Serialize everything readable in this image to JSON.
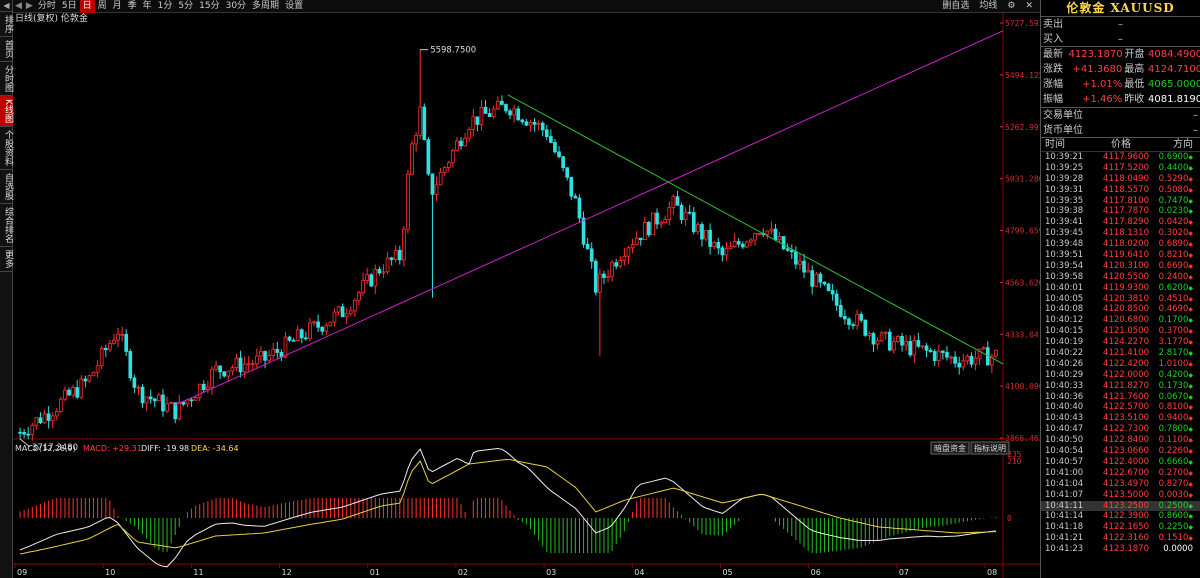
{
  "leftnav": {
    "items": [
      "排序",
      "首页",
      "分时图",
      "K线图",
      "个股资料",
      "自选股",
      "综合排名",
      "更多"
    ],
    "active_index": 3
  },
  "toolbar": {
    "items": [
      "分时",
      "5日",
      "日",
      "周",
      "月",
      "季",
      "年",
      "1分",
      "5分",
      "15分",
      "30分",
      "多周期",
      "设置"
    ],
    "selected": "日",
    "right_items": [
      "删自选",
      "均线"
    ]
  },
  "chart": {
    "title": "日线(复权) 伦敦金",
    "y_ticks": [
      "5727.591",
      "5494.125",
      "5262.997",
      "5031.280",
      "4799.659",
      "4563.626",
      "4333.041",
      "4100.096",
      "3866.463"
    ],
    "x_ticks": [
      "09",
      "10",
      "11",
      "12",
      "01",
      "02",
      "03",
      "04",
      "05",
      "06",
      "07",
      "08"
    ],
    "annot_high": "5598.7500",
    "annot_low": "3717.3480",
    "macd_label": "MACD(12,26,9)",
    "macd_value": "MACD: +29.31",
    "diff_value": "DIFF: -19.98",
    "dea_value": "DEA: -34.64",
    "macd_btn1": "暗盘资金",
    "macd_btn2": "指标说明",
    "macd_y_ticks": [
      "235",
      "210",
      "0"
    ]
  },
  "chart_data": {
    "type": "candlestick",
    "title": "日线(复权) 伦敦金",
    "ylim": [
      3717.348,
      5727.591
    ],
    "high": 5598.75,
    "low": 3717.348,
    "last": 4123.187,
    "x_labels": [
      "09",
      "10",
      "11",
      "12",
      "01",
      "02",
      "03",
      "04",
      "05",
      "06",
      "07",
      "08"
    ]
  },
  "quote": {
    "title": "伦敦金 XAUUSD",
    "sell_label": "卖出",
    "sell_val": "–",
    "buy_label": "买入",
    "buy_val": "–",
    "rows": [
      {
        "l1": "最新",
        "v1": "4123.1870",
        "c1": "red",
        "l2": "开盘",
        "v2": "4084.4900",
        "c2": "red"
      },
      {
        "l1": "涨跌",
        "v1": "+41.3680",
        "c1": "red",
        "l2": "最高",
        "v2": "4124.7100",
        "c2": "red"
      },
      {
        "l1": "涨幅",
        "v1": "+1.01%",
        "c1": "red",
        "l2": "最低",
        "v2": "4065.0000",
        "c2": "green"
      },
      {
        "l1": "振幅",
        "v1": "+1.46%",
        "c1": "red",
        "l2": "昨收",
        "v2": "4081.8190",
        "c2": "white"
      }
    ],
    "unit_label": "交易单位",
    "unit_val": "–",
    "currency_label": "货币单位",
    "currency_val": "–"
  },
  "ticks": {
    "headers": [
      "时间",
      "价格",
      "方向"
    ],
    "rows": [
      [
        "10:39:21",
        "4117.9600",
        "0.6900",
        "up"
      ],
      [
        "10:39:25",
        "4117.5200",
        "0.4400",
        "up"
      ],
      [
        "10:39:28",
        "4118.0490",
        "0.5290",
        "dn"
      ],
      [
        "10:39:31",
        "4118.5570",
        "0.5080",
        "dn"
      ],
      [
        "10:39:35",
        "4117.8100",
        "0.7470",
        "up"
      ],
      [
        "10:39:38",
        "4117.7870",
        "0.0230",
        "up"
      ],
      [
        "10:39:41",
        "4117.8290",
        "0.0420",
        "dn"
      ],
      [
        "10:39:45",
        "4118.1310",
        "0.3020",
        "dn"
      ],
      [
        "10:39:48",
        "4118.0200",
        "0.6890",
        "dn"
      ],
      [
        "10:39:51",
        "4119.6410",
        "0.8210",
        "dn"
      ],
      [
        "10:39:54",
        "4120.3100",
        "0.6690",
        "dn"
      ],
      [
        "10:39:58",
        "4120.5500",
        "0.2400",
        "dn"
      ],
      [
        "10:40:01",
        "4119.9300",
        "0.6200",
        "up"
      ],
      [
        "10:40:05",
        "4120.3810",
        "0.4510",
        "dn"
      ],
      [
        "10:40:08",
        "4120.8500",
        "0.4690",
        "dn"
      ],
      [
        "10:40:12",
        "4120.6800",
        "0.1700",
        "up"
      ],
      [
        "10:40:15",
        "4121.0500",
        "0.3700",
        "dn"
      ],
      [
        "10:40:19",
        "4124.2270",
        "3.1770",
        "dn"
      ],
      [
        "10:40:22",
        "4121.4100",
        "2.8170",
        "up"
      ],
      [
        "10:40:26",
        "4122.4200",
        "1.0100",
        "dn"
      ],
      [
        "10:40:29",
        "4122.0000",
        "0.4200",
        "up"
      ],
      [
        "10:40:33",
        "4121.8270",
        "0.1730",
        "up"
      ],
      [
        "10:40:36",
        "4121.7600",
        "0.0670",
        "up"
      ],
      [
        "10:40:40",
        "4122.5700",
        "0.8100",
        "dn"
      ],
      [
        "10:40:43",
        "4123.5100",
        "0.9400",
        "dn"
      ],
      [
        "10:40:47",
        "4122.7300",
        "0.7800",
        "up"
      ],
      [
        "10:40:50",
        "4122.8400",
        "0.1100",
        "dn"
      ],
      [
        "10:40:54",
        "4123.0660",
        "0.2260",
        "dn"
      ],
      [
        "10:40:57",
        "4122.4000",
        "0.6660",
        "up"
      ],
      [
        "10:41:00",
        "4122.6700",
        "0.2700",
        "dn"
      ],
      [
        "10:41:04",
        "4123.4970",
        "0.8270",
        "dn"
      ],
      [
        "10:41:07",
        "4123.5000",
        "0.0030",
        "dn"
      ],
      [
        "10:41:11",
        "4123.2500",
        "0.2500",
        "up"
      ],
      [
        "10:41:14",
        "4122.3900",
        "0.8600",
        "up"
      ],
      [
        "10:41:18",
        "4122.1650",
        "0.2250",
        "up"
      ],
      [
        "10:41:21",
        "4122.3160",
        "0.1510",
        "dn"
      ],
      [
        "10:41:23",
        "4123.1870",
        "0.0000",
        "eq"
      ]
    ]
  },
  "colors": {
    "up": "#ff3030",
    "down": "#30e0e0",
    "accent": "#b00000",
    "trend_green": "#2fc02f",
    "trend_magenta": "#d020d0"
  }
}
